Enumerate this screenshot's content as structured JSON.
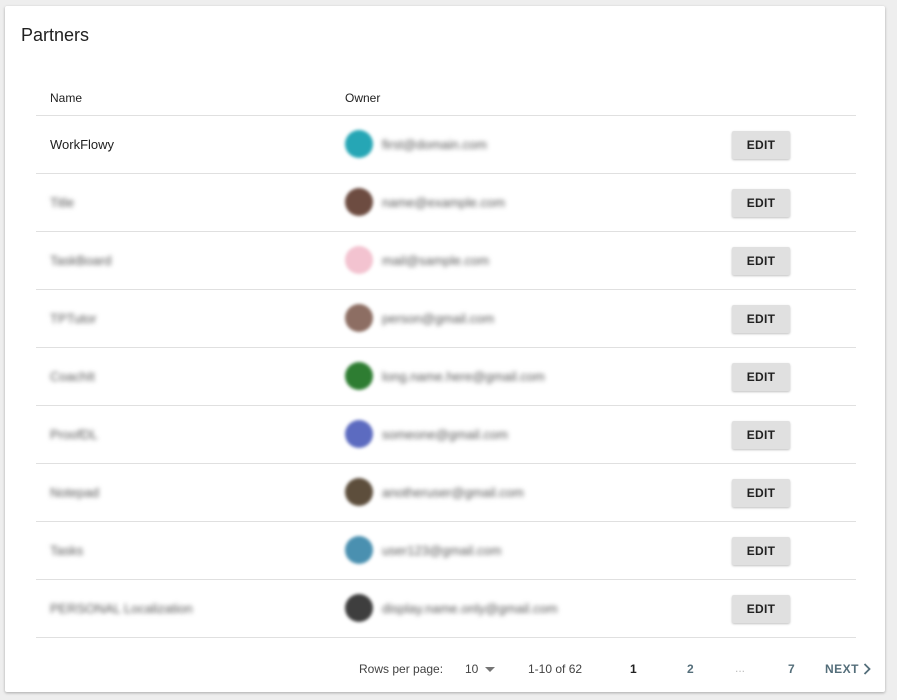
{
  "card": {
    "title": "Partners"
  },
  "table": {
    "columns": {
      "name": "Name",
      "owner": "Owner"
    },
    "rows": [
      {
        "name": "WorkFlowy",
        "name_blurred": false,
        "email": "first@domain.com",
        "avatar_color": "#26a6b5",
        "edit_label": "EDIT"
      },
      {
        "name": "Title",
        "name_blurred": true,
        "email": "name@example.com",
        "avatar_color": "#6d4c41",
        "edit_label": "EDIT"
      },
      {
        "name": "TaskBoard",
        "name_blurred": true,
        "email": "mail@sample.com",
        "avatar_color": "#f3c3d0",
        "edit_label": "EDIT"
      },
      {
        "name": "TPTutor",
        "name_blurred": true,
        "email": "person@gmail.com",
        "avatar_color": "#8d6e63",
        "edit_label": "EDIT"
      },
      {
        "name": "CoachIt",
        "name_blurred": true,
        "email": "long.name.here@gmail.com",
        "avatar_color": "#2e7d32",
        "edit_label": "EDIT"
      },
      {
        "name": "ProofDL",
        "name_blurred": true,
        "email": "someone@gmail.com",
        "avatar_color": "#5c6bc0",
        "edit_label": "EDIT"
      },
      {
        "name": "Notepad",
        "name_blurred": true,
        "email": "anotheruser@gmail.com",
        "avatar_color": "#5d4e3c",
        "edit_label": "EDIT"
      },
      {
        "name": "Tasks",
        "name_blurred": true,
        "email": "user123@gmail.com",
        "avatar_color": "#4a90b0",
        "edit_label": "EDIT"
      },
      {
        "name": "PERSONAL Localization",
        "name_blurred": true,
        "email": "display.name.only@gmail.com",
        "avatar_color": "#3e3e3e",
        "edit_label": "EDIT"
      }
    ]
  },
  "pagination": {
    "rows_per_page_label": "Rows per page:",
    "rows_per_page_value": "10",
    "range_text": "1-10 of 62",
    "pages": [
      "1",
      "2",
      "7"
    ],
    "ellipsis": "...",
    "current_page": "1",
    "next_label": "NEXT"
  }
}
